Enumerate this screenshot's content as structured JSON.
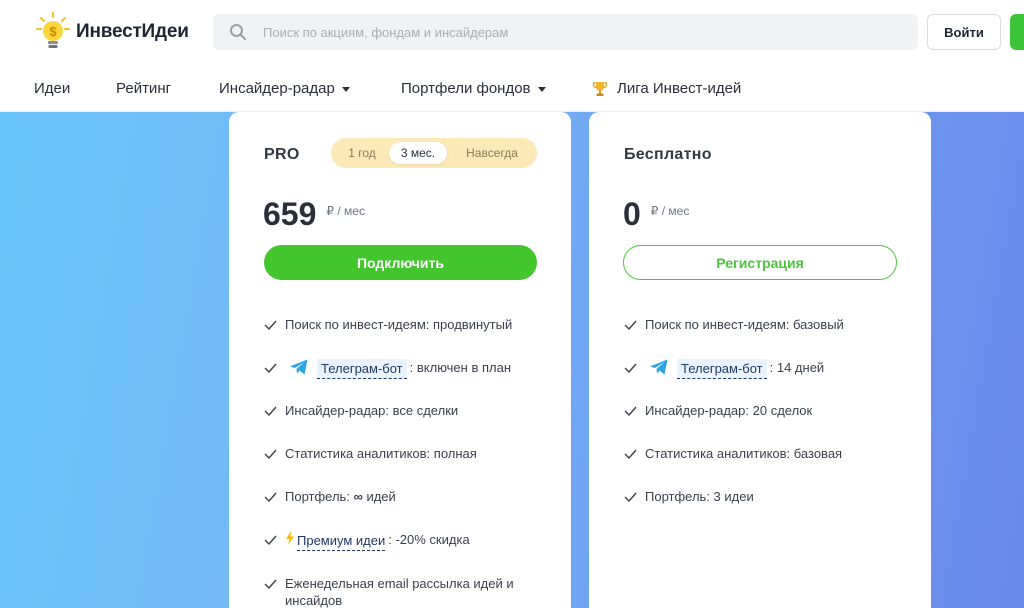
{
  "header": {
    "logo_text": "ИнвестИдеи",
    "search_placeholder": "Поиск по акциям, фондам и инсайдерам",
    "login_label": "Войти"
  },
  "nav": {
    "items": [
      {
        "label": "Идеи"
      },
      {
        "label": "Рейтинг"
      },
      {
        "label": "Инсайдер-радар"
      },
      {
        "label": "Портфели фондов"
      },
      {
        "label": "Лига Инвест-идей"
      }
    ]
  },
  "plans": {
    "pro": {
      "name": "PRO",
      "periods": [
        "1 год",
        "3 мес.",
        "Навсегда"
      ],
      "selected_period": "3 мес.",
      "price": "659",
      "unit": "₽ / мес",
      "cta": "Подключить",
      "features": [
        "Поиск по инвест-идеям: продвинутый",
        {
          "link": "Телеграм-бот",
          "text": ": включен в план"
        },
        "Инсайдер-радар: все сделки",
        "Статистика аналитиков: полная",
        {
          "prefix": "Портфель: ",
          "symbol": "∞",
          "suffix": " идей"
        },
        {
          "link": "Премиум идеи",
          "text": ": -20% скидка"
        },
        "Еженедельная email рассылка идей и инсайдов"
      ]
    },
    "free": {
      "name": "Бесплатно",
      "price": "0",
      "unit": "₽ / мес",
      "cta": "Регистрация",
      "features": [
        "Поиск по инвест-идеям: базовый",
        {
          "link": "Телеграм-бот",
          "text": ": 14 дней"
        },
        "Инсайдер-радар: 20 сделок",
        "Статистика аналитиков: базовая",
        "Портфель: 3 идеи"
      ]
    }
  },
  "colors": {
    "accent_green": "#43c52e",
    "toggle_bg": "#fde8b8",
    "background_gradient_start": "#6ac4fb",
    "background_gradient_end": "#6a8aea"
  }
}
